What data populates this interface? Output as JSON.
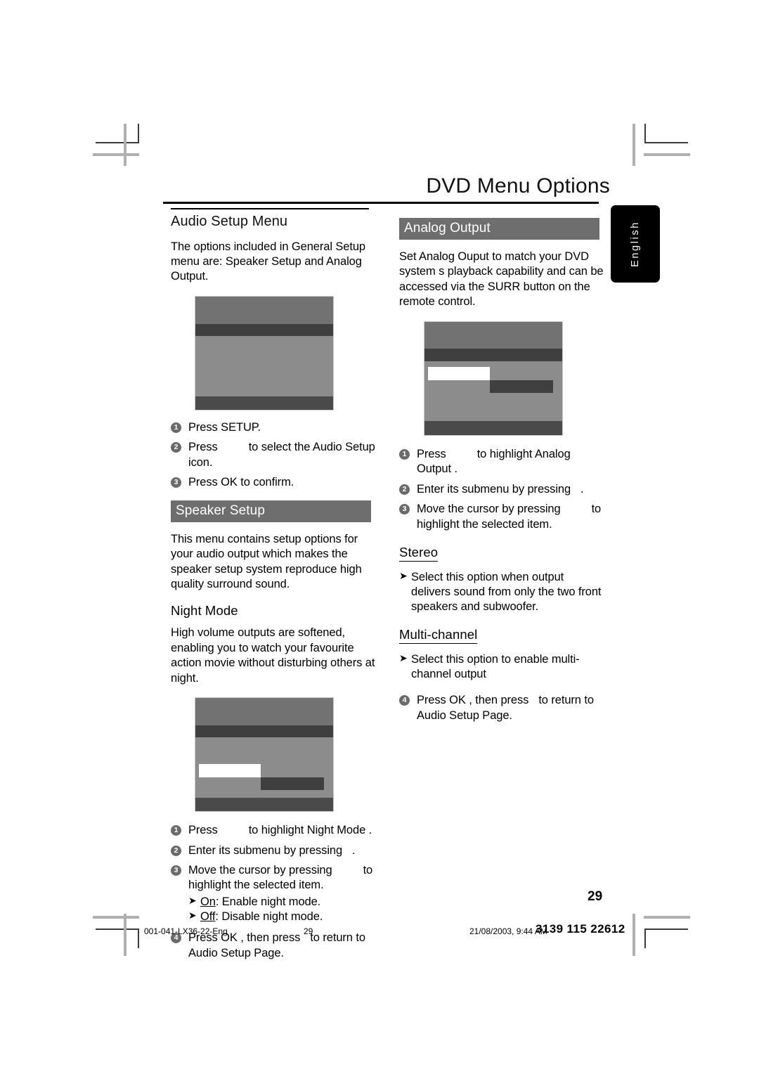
{
  "header": {
    "title": "DVD Menu Options"
  },
  "language_tab": {
    "label": "English"
  },
  "left_column": {
    "heading": "Audio Setup Menu",
    "intro": "The options included in General Setup menu are: Speaker Setup and Analog Output.",
    "steps_audio": [
      {
        "num": "1",
        "before": "Press SETUP.",
        "gap": false,
        "after": ""
      },
      {
        "num": "2",
        "before": "Press",
        "gap": true,
        "after": "to select the Audio Setup icon."
      },
      {
        "num": "3",
        "before": "Press OK  to confirm.",
        "gap": false,
        "after": ""
      }
    ],
    "speaker_setup": {
      "bar_title": "Speaker Setup",
      "body": "This menu contains setup options for your audio output which makes the speaker setup system reproduce high quality surround sound."
    },
    "night_mode": {
      "heading": "Night Mode",
      "body": "High volume outputs are softened, enabling you to watch your favourite action movie without disturbing others at night."
    },
    "steps_night": [
      {
        "num": "1",
        "before": "Press",
        "gap": true,
        "after": "to highlight  Night Mode ."
      },
      {
        "num": "2",
        "before": "Enter its submenu by pressing",
        "gap": true,
        "after": "."
      },
      {
        "num": "3",
        "before": "Move the cursor by pressing",
        "gap": true,
        "after": "to highlight the selected item."
      },
      {
        "num": "4",
        "before": "Press OK , then press",
        "gap": true,
        "after": "to return to Audio Setup Page."
      }
    ],
    "night_options": [
      {
        "term": "On",
        "desc": ": Enable night mode."
      },
      {
        "term": "Off",
        "desc": ": Disable night mode."
      }
    ]
  },
  "right_column": {
    "analog_output": {
      "bar_title": "Analog Output",
      "body": "Set Analog Ouput to match your DVD system s playback capability and can be accessed via the SURR button on the remote control."
    },
    "steps_analog": [
      {
        "num": "1",
        "before": "Press",
        "gap": true,
        "after": "to highlight  Analog Output ."
      },
      {
        "num": "2",
        "before": "Enter its submenu by pressing",
        "gap": true,
        "after": "."
      },
      {
        "num": "3",
        "before": "Move the cursor by pressing",
        "gap": true,
        "after": "to highlight the selected item."
      },
      {
        "num": "4",
        "before": "Press OK , then press",
        "gap": true,
        "after": "to return to Audio Setup Page."
      }
    ],
    "stereo": {
      "heading": "Stereo",
      "bullet": "Select this option when output delivers sound from only the two front speakers and subwoofer."
    },
    "multichannel": {
      "heading": "Multi-channel",
      "bullet": "Select this option to enable multi-channel output"
    }
  },
  "footer": {
    "folio": "29",
    "file_name": "001-041-LX36-22-Eng",
    "page_number": "29",
    "timestamp": "21/08/2003, 9:44 AM",
    "doc_code": "3139 115 22612"
  },
  "colors": {
    "bar_gray": "#6e6e6e",
    "screen_gray": "#8c8c8c",
    "screen_dark": "#3f3f3f",
    "number_badge": "#6a6a6a"
  }
}
